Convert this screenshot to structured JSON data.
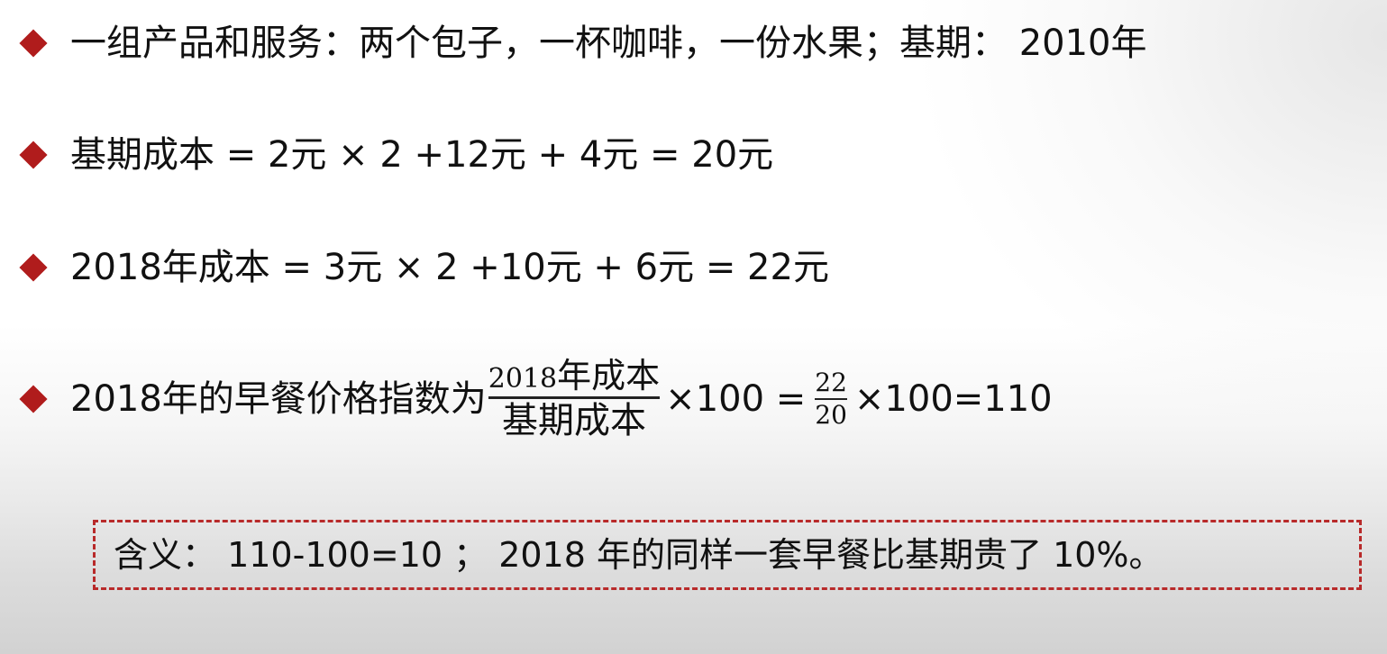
{
  "bullets": {
    "line1": "一组产品和服务：两个包子，一杯咖啡，一份水果；基期： 2010年",
    "line2": "基期成本 = 2元 × 2 +12元 + 4元 = 20元",
    "line3": "2018年成本 = 3元 × 2 +10元 + 6元 = 22元",
    "line4": {
      "prefix": "2018年的早餐价格指数为",
      "frac1_num_year": "2018",
      "frac1_num_rest": "年成本",
      "frac1_den": "基期成本",
      "mid": "×100 =",
      "frac2_num": "22",
      "frac2_den": "20",
      "suffix": "×100=110"
    }
  },
  "meaning": "含义： 110-100=10 ； 2018 年的同样一套早餐比基期贵了 10%。",
  "colors": {
    "bullet": "#b01c1c",
    "dashed_border": "#b82a2a"
  }
}
